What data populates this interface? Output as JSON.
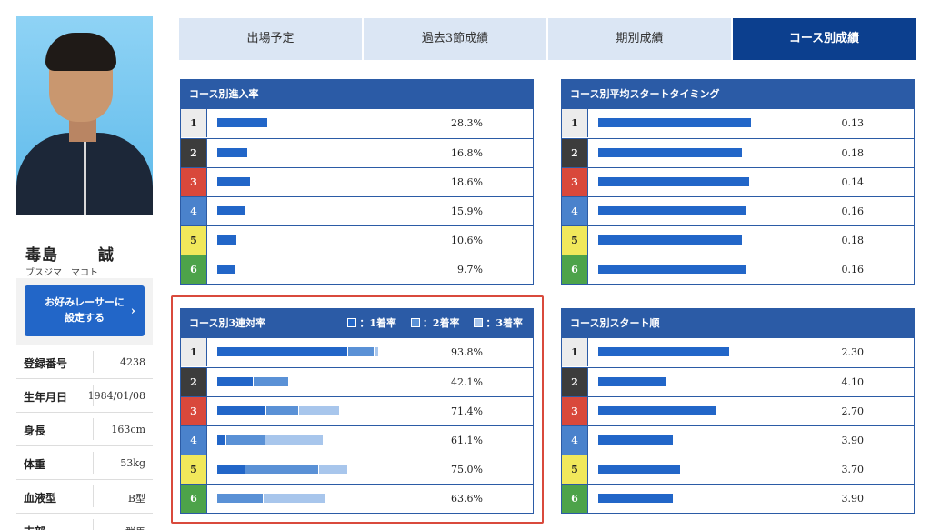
{
  "sidebar": {
    "name_surname": "毒島",
    "name_given": "誠",
    "kana": "ブスジマ　マコト",
    "fav_button": [
      "お好みレーサーに",
      "設定する"
    ],
    "info": [
      {
        "label": "登録番号",
        "value": "4238"
      },
      {
        "label": "生年月日",
        "value": "1984/01/08"
      },
      {
        "label": "身長",
        "value": "163cm"
      },
      {
        "label": "体重",
        "value": "53kg"
      },
      {
        "label": "血液型",
        "value": "B型"
      },
      {
        "label": "支部",
        "value": "群馬"
      }
    ]
  },
  "tabs": [
    "出場予定",
    "過去3節成績",
    "期別成績",
    "コース別成績"
  ],
  "active_tab": 3,
  "colors": {
    "lane_bg": [
      "#ececec",
      "#3c3c3c",
      "#d9483b",
      "#4a82cc",
      "#f1e85b",
      "#4da34a"
    ],
    "lane_fg": [
      "#222",
      "#fff",
      "#fff",
      "#fff",
      "#222",
      "#fff"
    ],
    "bar1": "#2266c8",
    "bar2": "#5a91d6",
    "bar3": "#a8c6ec",
    "highlight": "#d94a3c"
  },
  "panels": {
    "entry_rate": {
      "title": "コース別進入率",
      "rows": [
        {
          "lane": "1",
          "value": "28.3%",
          "bar": 28.3
        },
        {
          "lane": "2",
          "value": "16.8%",
          "bar": 16.8
        },
        {
          "lane": "3",
          "value": "18.6%",
          "bar": 18.6
        },
        {
          "lane": "4",
          "value": "15.9%",
          "bar": 15.9
        },
        {
          "lane": "5",
          "value": "10.6%",
          "bar": 10.6
        },
        {
          "lane": "6",
          "value": "9.7%",
          "bar": 9.7
        }
      ]
    },
    "start_timing": {
      "title": "コース別平均スタートタイミング",
      "rows": [
        {
          "lane": "1",
          "value": "0.13"
        },
        {
          "lane": "2",
          "value": "0.18"
        },
        {
          "lane": "3",
          "value": "0.14"
        },
        {
          "lane": "4",
          "value": "0.16"
        },
        {
          "lane": "5",
          "value": "0.18"
        },
        {
          "lane": "6",
          "value": "0.16"
        }
      ]
    },
    "top3_rate": {
      "title": "コース別3連対率",
      "legend": [
        "：1着率",
        "：2着率",
        "：3着率"
      ],
      "rows": [
        {
          "lane": "1",
          "value": "93.8%",
          "segs": [
            65.0,
            13.0,
            2.0
          ]
        },
        {
          "lane": "2",
          "value": "42.1%",
          "segs": [
            18.0,
            17.5,
            0
          ]
        },
        {
          "lane": "3",
          "value": "71.4%",
          "segs": [
            24.5,
            16.0,
            20.5
          ]
        },
        {
          "lane": "4",
          "value": "61.1%",
          "segs": [
            4.5,
            19.5,
            28.5
          ]
        },
        {
          "lane": "5",
          "value": "75.0%",
          "segs": [
            14.0,
            36.5,
            14.5
          ]
        },
        {
          "lane": "6",
          "value": "63.6%",
          "segs": [
            0,
            23.0,
            31.0
          ]
        }
      ]
    },
    "start_order": {
      "title": "コース別スタート順",
      "rows": [
        {
          "lane": "1",
          "value": "2.30"
        },
        {
          "lane": "2",
          "value": "4.10"
        },
        {
          "lane": "3",
          "value": "2.70"
        },
        {
          "lane": "4",
          "value": "3.90"
        },
        {
          "lane": "5",
          "value": "3.70"
        },
        {
          "lane": "6",
          "value": "3.90"
        }
      ]
    }
  }
}
